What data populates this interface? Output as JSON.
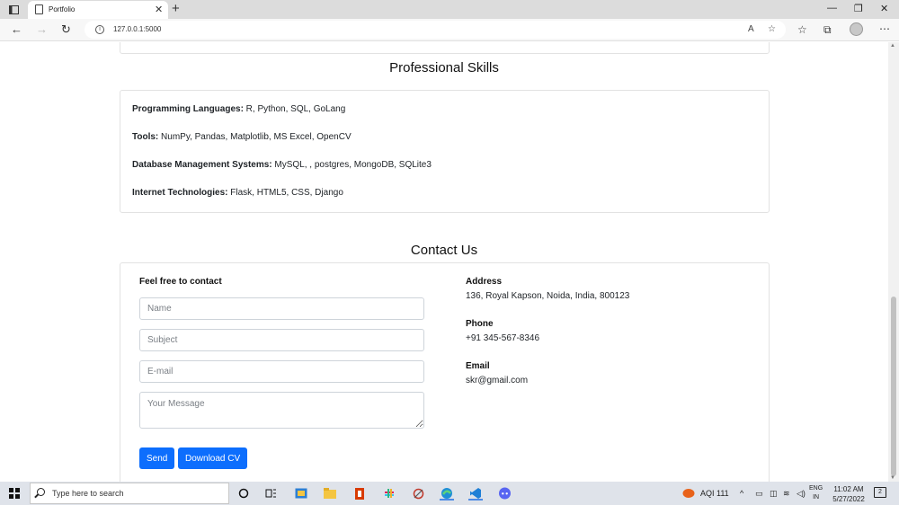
{
  "browser": {
    "tab_title": "Portfolio",
    "url": "127.0.0.1:5000",
    "tab_close": "✕",
    "new_tab": "+"
  },
  "skills": {
    "title": "Professional Skills",
    "items": [
      {
        "label": "Programming Languages:",
        "value": " R, Python, SQL, GoLang"
      },
      {
        "label": "Tools:",
        "value": " NumPy, Pandas, Matplotlib, MS Excel, OpenCV"
      },
      {
        "label": "Database Management Systems:",
        "value": " MySQL, , postgres, MongoDB, SQLite3"
      },
      {
        "label": "Internet Technologies:",
        "value": " Flask, HTML5, CSS, Django"
      }
    ]
  },
  "contact": {
    "title": "Contact Us",
    "form_heading": "Feel free to contact",
    "placeholders": {
      "name": "Name",
      "subject": "Subject",
      "email": "E-mail",
      "message": "Your Message"
    },
    "send_label": "Send",
    "download_label": "Download CV",
    "address_label": "Address",
    "address_value": "136, Royal Kapson, Noida, India, 800123",
    "phone_label": "Phone",
    "phone_value": "+91 345-567-8346",
    "email_label": "Email",
    "email_value": "skr@gmail.com"
  },
  "taskbar": {
    "search_placeholder": "Type here to search",
    "aqi": "AQI 111",
    "lang_line1": "ENG",
    "lang_line2": "IN",
    "time": "11:02 AM",
    "date": "5/27/2022",
    "notification_count": "2"
  },
  "colors": {
    "primary_button": "#0d6efd",
    "taskbar_bg": "#dfe3ea"
  }
}
